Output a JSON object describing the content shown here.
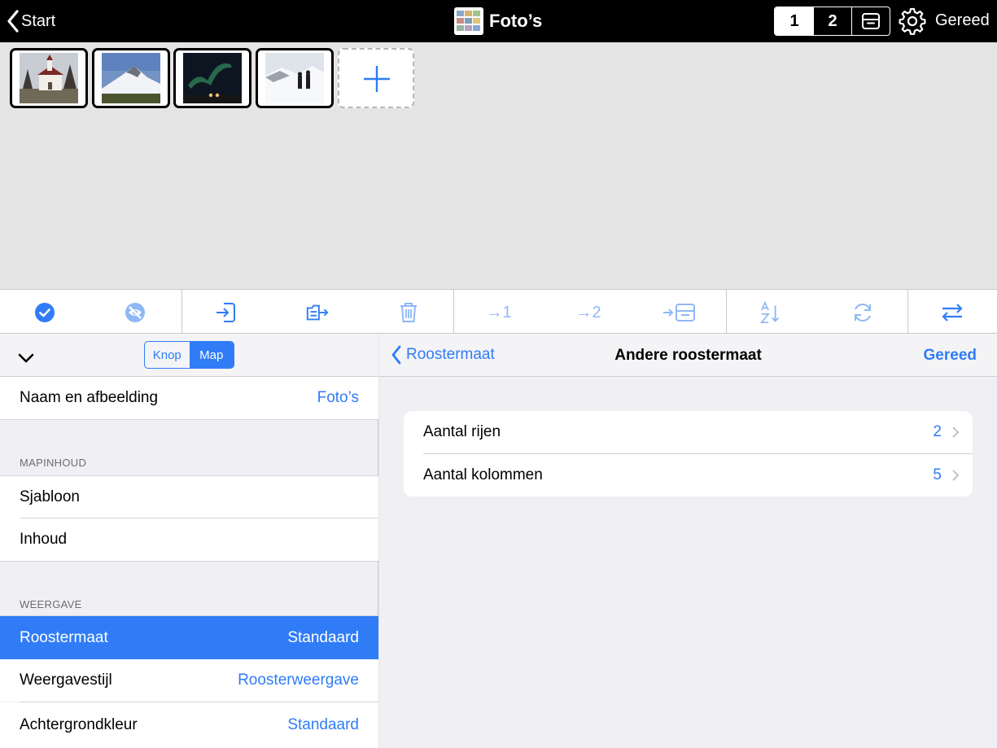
{
  "topbar": {
    "back_label": "Start",
    "title": "Foto’s",
    "pages": [
      "1",
      "2"
    ],
    "active_page": "1",
    "done_label": "Gereed"
  },
  "thumbnails": [
    {
      "subject": "church"
    },
    {
      "subject": "snowy mountain"
    },
    {
      "subject": "northern lights"
    },
    {
      "subject": "people in snow"
    }
  ],
  "toolbar": {
    "move_1": "→1",
    "move_2": "→2",
    "icons": [
      "check-circle-icon",
      "hide-icon",
      "import-icon",
      "export-icon",
      "trash-icon",
      "move-to-1-icon",
      "move-to-2-icon",
      "move-to-archive-icon",
      "sort-az-icon",
      "refresh-icon",
      "swap-icon"
    ]
  },
  "left": {
    "segments": [
      "Knop",
      "Map"
    ],
    "active_segment": "Map",
    "name_row": {
      "label": "Naam en afbeelding",
      "value": "Foto’s"
    },
    "section1": "MAPINHOUD",
    "template_label": "Sjabloon",
    "content_label": "Inhoud",
    "section2": "WEERGAVE",
    "grid_row": {
      "label": "Roostermaat",
      "value": "Standaard"
    },
    "style_row": {
      "label": "Weergavestijl",
      "value": "Roosterweergave"
    },
    "bg_row": {
      "label": "Achtergrondkleur",
      "value": "Standaard"
    }
  },
  "right": {
    "back_label": "Roostermaat",
    "title": "Andere roostermaat",
    "done_label": "Gereed",
    "rows_row": {
      "label": "Aantal rijen",
      "value": "2"
    },
    "cols_row": {
      "label": "Aantal kolommen",
      "value": "5"
    }
  },
  "colors": {
    "accent": "#2f7cf6",
    "topbar": "#000000",
    "background": "#efeff4"
  }
}
